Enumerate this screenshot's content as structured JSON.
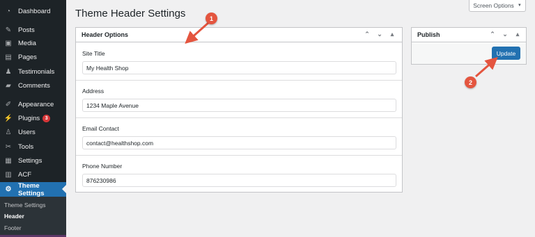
{
  "sidebar": {
    "items": [
      {
        "label": "Dashboard",
        "icon": "dashboard-icon",
        "glyph": "◔"
      },
      {
        "label": "Posts",
        "icon": "pin-icon",
        "glyph": "✎"
      },
      {
        "label": "Media",
        "icon": "media-icon",
        "glyph": "▣"
      },
      {
        "label": "Pages",
        "icon": "pages-icon",
        "glyph": "▤"
      },
      {
        "label": "Testimonials",
        "icon": "person-icon",
        "glyph": "♟"
      },
      {
        "label": "Comments",
        "icon": "comment-icon",
        "glyph": "▰"
      },
      {
        "label": "Appearance",
        "icon": "brush-icon",
        "glyph": "✐"
      },
      {
        "label": "Plugins",
        "icon": "plug-icon",
        "glyph": "⚡",
        "badge": "3"
      },
      {
        "label": "Users",
        "icon": "users-icon",
        "glyph": "♙"
      },
      {
        "label": "Tools",
        "icon": "wrench-icon",
        "glyph": "✂"
      },
      {
        "label": "Settings",
        "icon": "settings-icon",
        "glyph": "▦"
      },
      {
        "label": "ACF",
        "icon": "acf-icon",
        "glyph": "▥"
      },
      {
        "label": "Theme Settings",
        "icon": "gear-icon",
        "glyph": "⚙"
      }
    ],
    "submenu": [
      "Theme Settings",
      "Header",
      "Footer"
    ]
  },
  "page": {
    "title": "Theme Header Settings",
    "screen_options": "Screen Options"
  },
  "header_options": {
    "title": "Header Options",
    "fields": [
      {
        "label": "Site Title",
        "value": "My Health Shop"
      },
      {
        "label": "Address",
        "value": "1234 Maple Avenue"
      },
      {
        "label": "Email Contact",
        "value": "contact@healthshop.com"
      },
      {
        "label": "Phone Number",
        "value": "876230986"
      }
    ]
  },
  "publish": {
    "title": "Publish",
    "update_label": "Update"
  },
  "annotations": {
    "marker1": "1",
    "marker2": "2"
  },
  "colors": {
    "accent": "#2271b1",
    "sidebar_bg": "#1d2327",
    "badge": "#d63638",
    "annotation": "#e4553f"
  }
}
